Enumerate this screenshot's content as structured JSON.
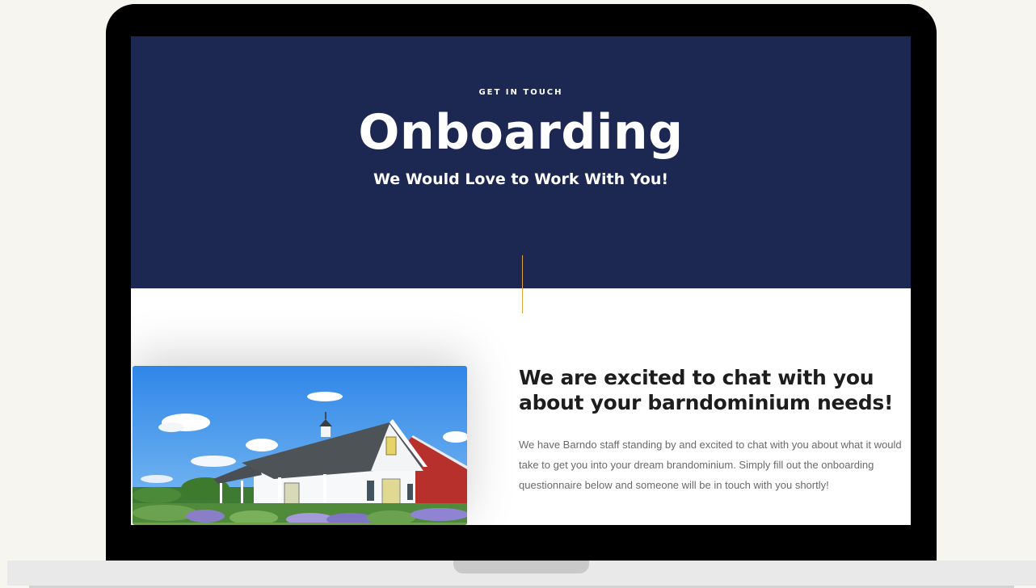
{
  "hero": {
    "eyebrow": "GET IN TOUCH",
    "title": "Onboarding",
    "subtitle": "We Would Love to Work With You!",
    "background_color": "#1c2752",
    "accent_line_color": "#e0a23a"
  },
  "content": {
    "heading": "We are excited to chat with you about your barndominium needs!",
    "body": "We have Barndo staff standing by and excited to chat with you about what it would take to get you into your dream brandominium. Simply fill out the onboarding questionnaire below and someone will be in touch with you shortly!",
    "image_icon": "barn-house-photo"
  }
}
